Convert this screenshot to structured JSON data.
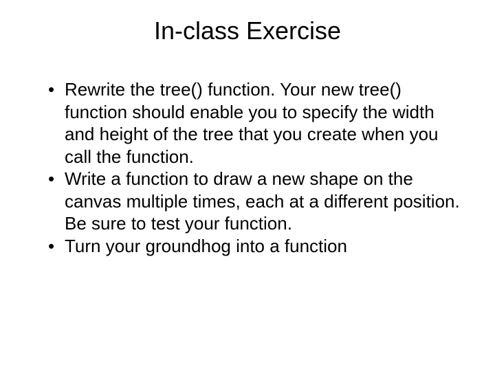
{
  "title": "In-class Exercise",
  "bullets": [
    "Rewrite the tree() function.  Your new tree() function should enable you to specify the width and height of the tree that you create when you call the function.",
    "Write a function to draw a new shape on the canvas multiple times, each at a different position.  Be sure to test your function.",
    "Turn your groundhog into a function"
  ]
}
